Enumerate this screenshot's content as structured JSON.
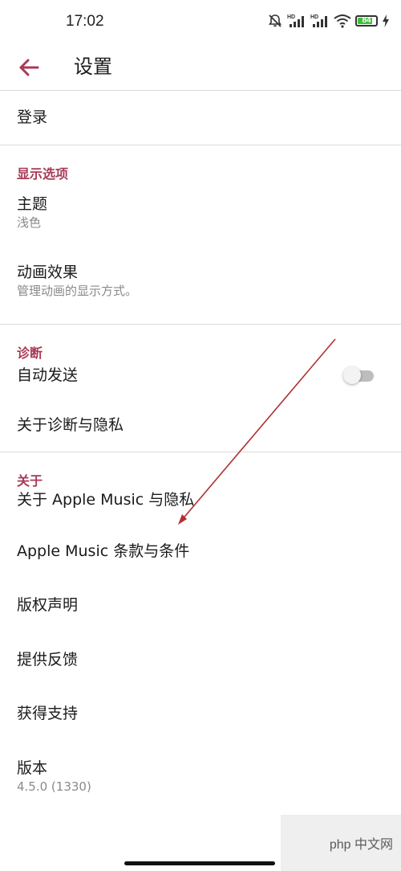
{
  "status_bar": {
    "time": "17:02",
    "battery": "84",
    "battery_level": 0.84,
    "icons": [
      "mute-icon",
      "hd-signal-icon",
      "hd-signal-icon",
      "wifi-icon",
      "battery-icon",
      "charging-icon"
    ]
  },
  "app_bar": {
    "title": "设置",
    "back_icon": "arrow-left-icon"
  },
  "rows": {
    "login": "登录",
    "theme": "主题",
    "theme_value": "浅色",
    "animation": "动画效果",
    "animation_sub": "管理动画的显示方式。",
    "auto_send": "自动发送",
    "auto_send_on": false,
    "about_diagnostics": "关于诊断与隐私",
    "about_apple_music": "关于 Apple Music 与隐私",
    "terms": "Apple Music 条款与条件",
    "copyright": "版权声明",
    "feedback": "提供反馈",
    "support": "获得支持",
    "version": "版本",
    "version_value": "4.5.0 (1330)"
  },
  "sections": {
    "display": "显示选项",
    "diagnostics": "诊断",
    "about": "关于"
  },
  "watermark": "php 中文网",
  "colors": {
    "accent": "#a83a57",
    "annotation_arrow": "#b03030",
    "battery_fill": "#3cbf3c"
  }
}
